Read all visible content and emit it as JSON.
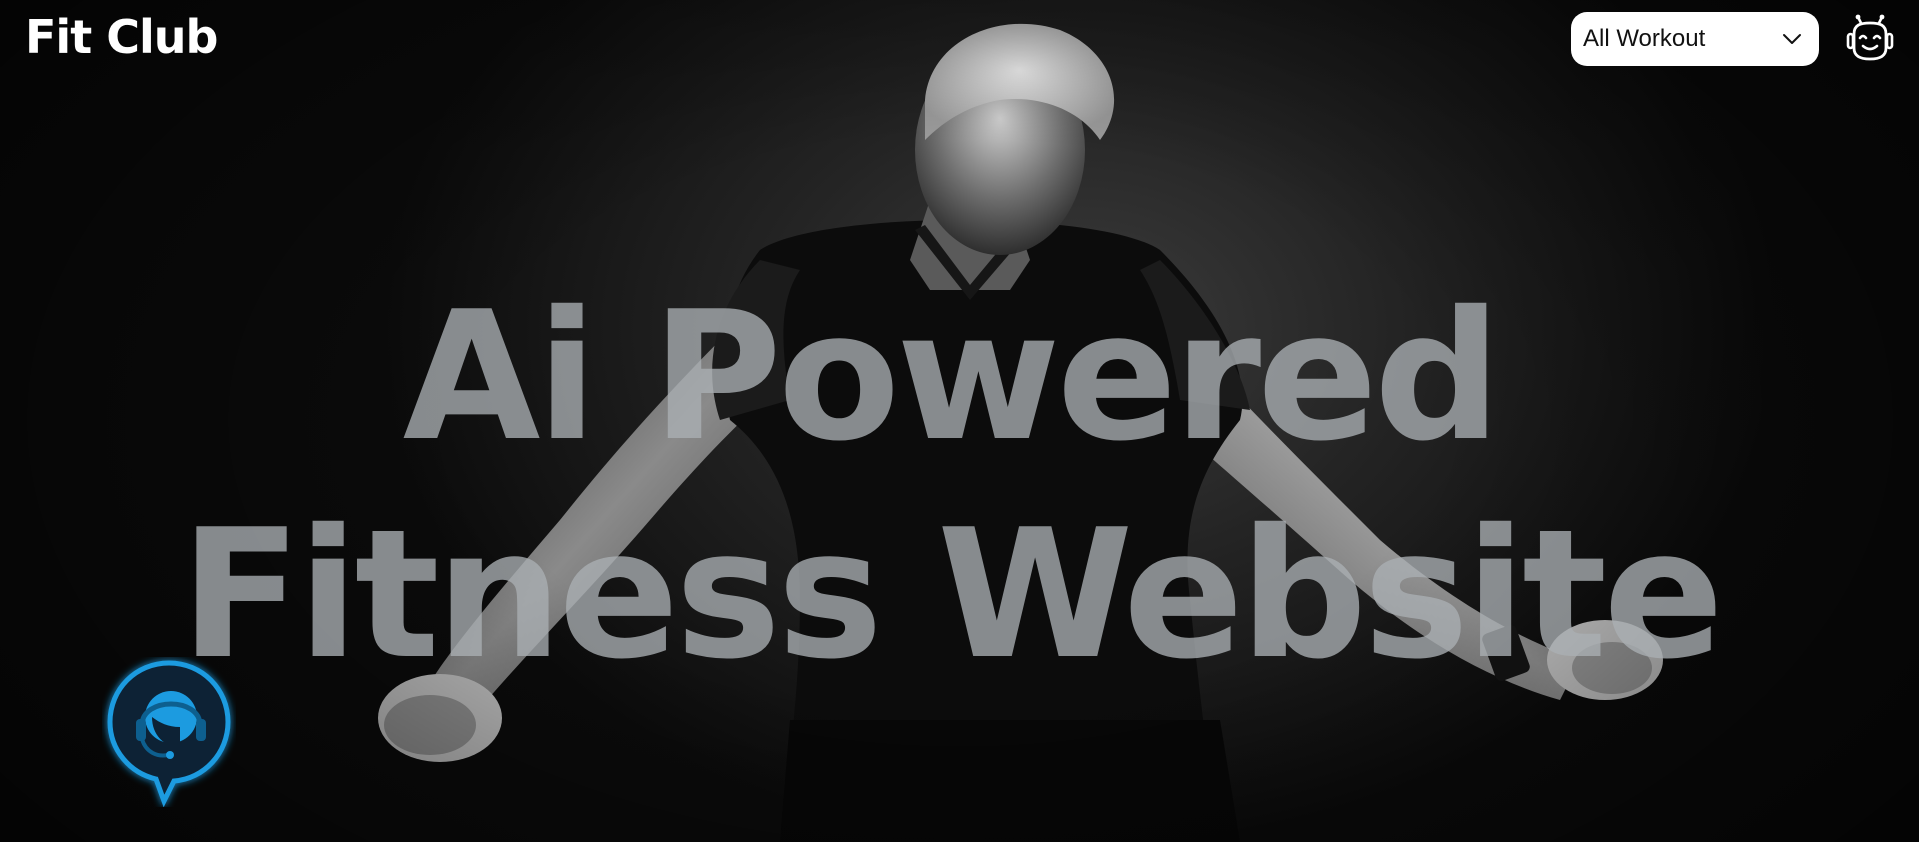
{
  "header": {
    "brand": "Fit Club",
    "workout_select": {
      "selected": "All Workout"
    },
    "assistant_icon": "robot-assistant-icon"
  },
  "hero": {
    "title": "Ai Powered Fitness Website"
  },
  "floating": {
    "support_icon": "headset-support-icon",
    "accent_color": "#1e9be0"
  },
  "colors": {
    "background": "#000000",
    "title_overlay": "#aaafb4",
    "brand_text": "#ffffff"
  }
}
